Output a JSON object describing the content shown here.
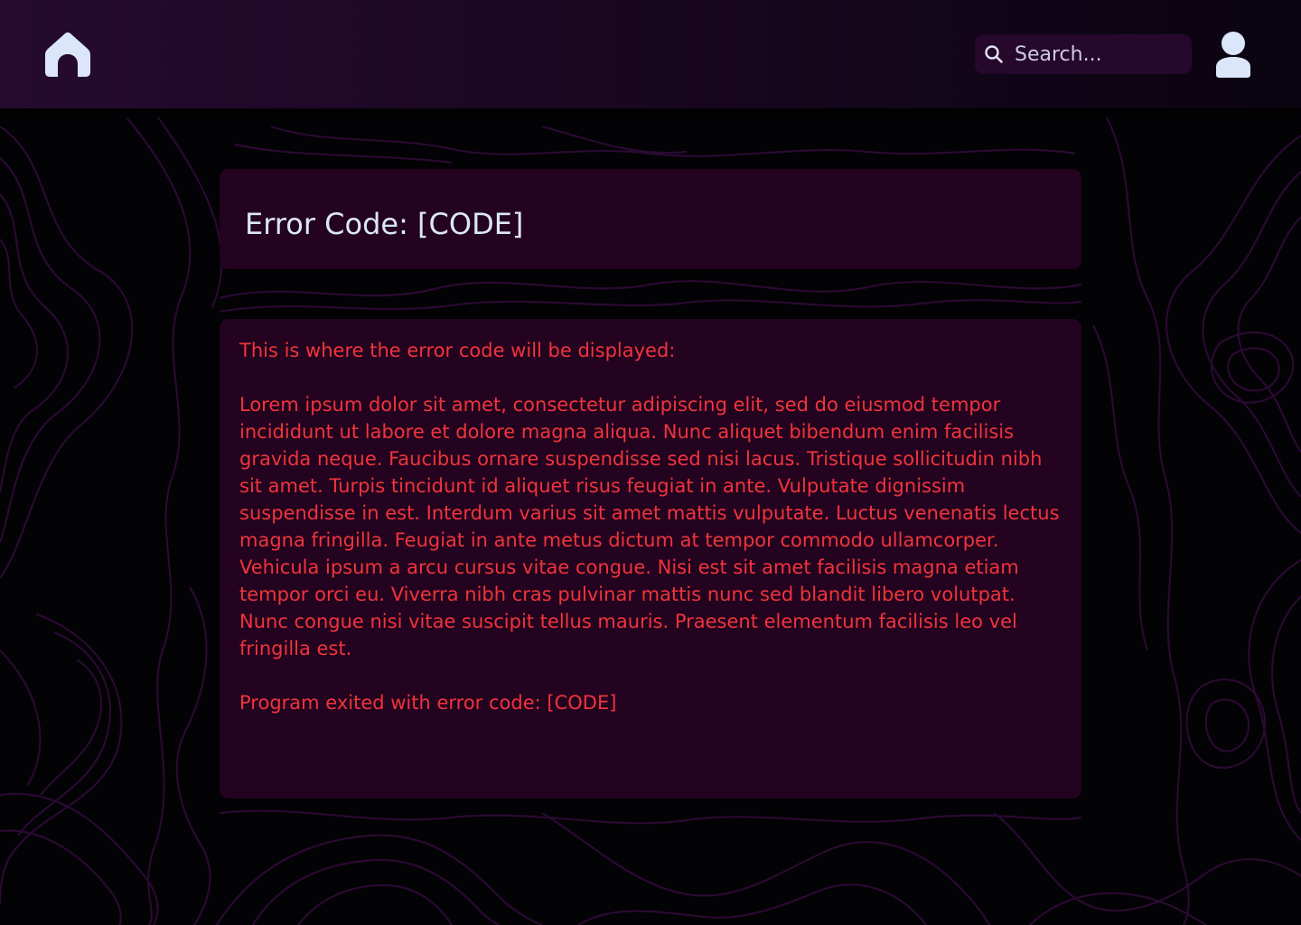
{
  "header": {
    "home_icon": "home-icon",
    "search": {
      "icon": "search-icon",
      "placeholder": "Search..."
    },
    "user_icon": "user-icon"
  },
  "error": {
    "title": "Error Code: [CODE]",
    "intro": "This is where the error code will be displayed:",
    "body": "Lorem ipsum dolor sit amet, consectetur adipiscing elit, sed do eiusmod  tempor incididunt ut labore et dolore magna aliqua. Nunc aliquet  bibendum enim facilisis gravida neque. Faucibus ornare suspendisse sed  nisi lacus. Tristique sollicitudin nibh sit amet. Turpis tincidunt id  aliquet risus feugiat in ante. Vulputate dignissim suspendisse in est.  Interdum varius sit amet mattis vulputate. Luctus venenatis lectus magna  fringilla. Feugiat in ante metus dictum at tempor commodo ullamcorper.  Vehicula ipsum a arcu cursus vitae congue. Nisi est sit amet facilisis magna etiam tempor orci eu. Viverra nibh cras pulvinar mattis nunc sed  blandit libero volutpat. Nunc congue nisi vitae suscipit tellus mauris.  Praesent elementum facilisis leo vel fringilla est.",
    "footer": "Program exited with error code: [CODE]"
  },
  "colors": {
    "background": "#030204",
    "header_gradient_start": "#260a30",
    "panel": "#23031f",
    "title_text": "#dbe6fb",
    "error_text": "#f0343c",
    "icon": "#dbe6fb",
    "topo_lines": "#2a0a33"
  }
}
